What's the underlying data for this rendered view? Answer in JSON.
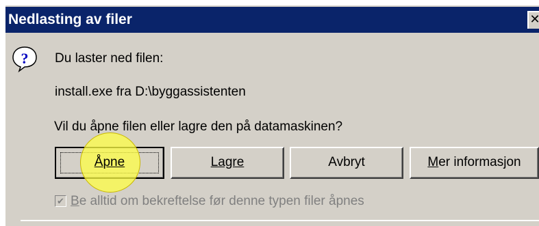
{
  "window": {
    "title": "Nedlasting av filer",
    "close_glyph": "✕"
  },
  "message": {
    "line1": "Du laster ned filen:",
    "file": "install.exe fra D:\\byggassistenten",
    "question": "Vil du åpne filen eller lagre den på datamaskinen?"
  },
  "buttons": {
    "open": "Åpne",
    "save": "Lagre",
    "cancel": "Avbryt",
    "more_info": "Mer informasjon"
  },
  "checkbox": {
    "label": "Be alltid om bekreftelse før denne typen filer åpnes",
    "checked": true,
    "disabled": true
  },
  "icons": {
    "question": "question-icon",
    "close": "close-icon"
  },
  "colors": {
    "titlebar": "#0a246a",
    "dialog_bg": "#d4d0c8",
    "highlight": "#ffff46"
  }
}
